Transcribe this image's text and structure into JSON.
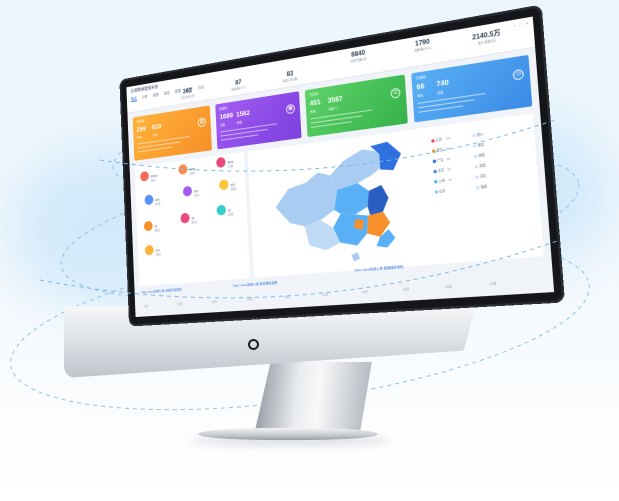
{
  "dashboard": {
    "app_title": "后端数据管理系统",
    "tabs": [
      "概览",
      "分析",
      "报表",
      "监控",
      "配置",
      "权限",
      "日志"
    ],
    "active_tab": 0,
    "stats": [
      {
        "value": "362",
        "label": "今日访问(次)"
      },
      {
        "value": "87",
        "label": "在线用户(个)"
      },
      {
        "value": "83",
        "label": "新增订单(笔)"
      },
      {
        "value": "8840",
        "label": "总访问量(次)"
      },
      {
        "value": "1790",
        "label": "注册用户(人)"
      },
      {
        "value": "2140.5万",
        "label": "累计金额(元)"
      }
    ],
    "cards": [
      {
        "label": "待处理",
        "nums": [
          "259",
          "620"
        ],
        "units": [
          "件数",
          "订单"
        ],
        "icon": "chart-icon"
      },
      {
        "label": "处理中",
        "nums": [
          "1689",
          "1562"
        ],
        "units": [
          "次数",
          "单量"
        ],
        "icon": "document-icon"
      },
      {
        "label": "已完成",
        "nums": [
          "451",
          "3587"
        ],
        "units": [
          "件数",
          "总数(个)"
        ],
        "icon": "scale-icon"
      },
      {
        "label": "已审核",
        "nums": [
          "66",
          "740"
        ],
        "units": [
          "审核",
          "总数"
        ],
        "icon": "clock-icon"
      }
    ],
    "bubbles": [
      {
        "value": "30567",
        "label": "用户",
        "color": "#f26b5b"
      },
      {
        "value": "9999",
        "label": "访客",
        "color": "#f98b4c"
      },
      {
        "value": "4829",
        "label": "订单",
        "color": "#e84b7a"
      },
      {
        "value": "245",
        "label": "商品",
        "color": "#5b8ff9"
      },
      {
        "value": "553",
        "label": "评论",
        "color": "#a35cf2"
      },
      {
        "value": "320",
        "label": "收藏",
        "color": "#ffc53d"
      },
      {
        "value": "33",
        "label": "退款",
        "color": "#f7902a"
      },
      {
        "value": "28",
        "label": "投诉",
        "color": "#e84b7a"
      },
      {
        "value": "20",
        "label": "反馈",
        "color": "#36cfc9"
      },
      {
        "value": "234",
        "label": "活跃",
        "color": "#ffb238"
      }
    ],
    "legend": [
      {
        "name": "江苏",
        "value": "156",
        "color": "#f04864"
      },
      {
        "name": "浙江",
        "value": "98",
        "color": "#f7902a"
      },
      {
        "name": "广东",
        "value": "86",
        "color": "#2f6fe0"
      },
      {
        "name": "北京",
        "value": "65",
        "color": "#3a8be6"
      },
      {
        "name": "上海",
        "value": "42",
        "color": "#5ab0f5"
      },
      {
        "name": "山东",
        "value": "",
        "color": "#9fc7f2"
      },
      {
        "name": "四川",
        "value": "",
        "color": "#cfe3f8"
      },
      {
        "name": "湖北",
        "value": "",
        "color": "#cfe3f8"
      },
      {
        "name": "湖南",
        "value": "",
        "color": "#cfe3f8"
      },
      {
        "name": "河南",
        "value": "",
        "color": "#cfe3f8"
      },
      {
        "name": "河北",
        "value": "",
        "color": "#cfe3f8"
      },
      {
        "name": "福建",
        "value": "",
        "color": "#cfe3f8"
      }
    ],
    "links": [
      "Marx Jeeni系统公告 系统升级通知",
      "Marx Jeeni系统公告 版本更新说明",
      "Marx Jeeni系统公告 数据维护通知"
    ],
    "axis_labels": [
      "01月",
      "02月",
      "03月",
      "04月",
      "05月",
      "06月",
      "07月",
      "08月",
      "09月",
      "10月"
    ]
  }
}
